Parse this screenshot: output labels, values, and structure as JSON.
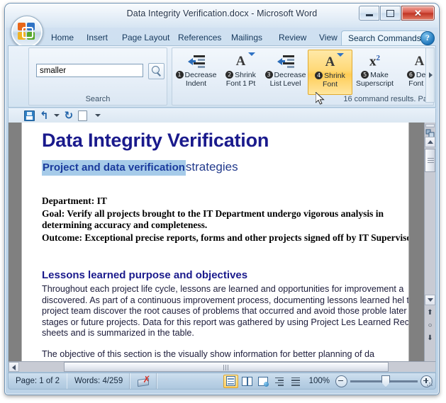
{
  "window": {
    "title": "Data Integrity Verification.docx - Microsoft Word",
    "office_button": "office-orb",
    "minimize_label": "",
    "maximize_label": "",
    "close_label": "✕"
  },
  "tabs": [
    {
      "label": "Home",
      "active": false
    },
    {
      "label": "Insert",
      "active": false
    },
    {
      "label": "Page Layout",
      "active": false
    },
    {
      "label": "References",
      "active": false
    },
    {
      "label": "Mailings",
      "active": false
    },
    {
      "label": "Review",
      "active": false
    },
    {
      "label": "View",
      "active": false
    },
    {
      "label": "Search Commands",
      "active": true
    }
  ],
  "help": {
    "label": "?"
  },
  "ribbon": {
    "search_group": {
      "label": "Search",
      "input_value": "smaller",
      "input_placeholder": "",
      "go_icon": "magnifier-icon"
    },
    "results_group": {
      "commands": [
        {
          "num": "1",
          "line1": "Decrease",
          "line2": "Indent",
          "icon": "decrease-indent-icon",
          "selected": false,
          "dropdown": false
        },
        {
          "num": "2",
          "line1": "Shrink",
          "line2": "Font 1 Pt",
          "icon": "font-a-icon",
          "selected": false,
          "dropdown": true
        },
        {
          "num": "3",
          "line1": "Decrease",
          "line2": "List Level",
          "icon": "decrease-indent-icon",
          "selected": false,
          "dropdown": false
        },
        {
          "num": "4",
          "line1": "Shrink",
          "line2": "Font",
          "icon": "font-a-icon",
          "selected": true,
          "dropdown": true
        },
        {
          "num": "5",
          "line1": "Make",
          "line2": "Superscript",
          "icon": "superscript-icon",
          "selected": false,
          "dropdown": false
        },
        {
          "num": "6",
          "line1": "Decr",
          "line2": "Font S",
          "icon": "font-a-icon",
          "selected": false,
          "dropdown": true
        }
      ],
      "results_note": "16 command results. Pa"
    }
  },
  "quick_access": {
    "items": [
      {
        "name": "save-icon",
        "label": ""
      },
      {
        "name": "undo-icon",
        "label": "↰"
      },
      {
        "name": "undo-dropdown-icon",
        "label": ""
      },
      {
        "name": "redo-icon",
        "label": "↻"
      },
      {
        "name": "new-document-icon",
        "label": ""
      },
      {
        "name": "customize-qat-icon",
        "label": ""
      }
    ]
  },
  "document": {
    "title": "Data Integrity Verification",
    "subtitle_selected": "Project and data verification",
    "subtitle_rest": "strategies",
    "meta": [
      "Department:  IT",
      "Goal:  Verify all projects brought to the IT Department  undergo vigorous analysis in determining accuracy  and completeness.",
      "Outcome:  Exceptional precise reports, forms and other projects signed off by IT Supervisor."
    ],
    "heading2": "Lessons learned purpose and objectives",
    "paragraph1": "Throughout each  project life cycle, lessons are learned  and opportunities for improvement a discovered. As part of a continuous improvement process, documenting lessons learned hel the project team discover the root causes of problems that occurred and avoid those proble later project stages or future projects. Data for this report was  gathered by using Project Les Learned Record sheets and is summarized in the table.",
    "paragraph2": "The objective of this section is the visually show information for better planning of da"
  },
  "statusbar": {
    "page": "Page: 1 of 2",
    "words": "Words: 4/259",
    "proofing_icon": "spelling-errors-icon",
    "views": [
      {
        "name": "print-layout-view",
        "active": true
      },
      {
        "name": "full-screen-reading-view",
        "active": false
      },
      {
        "name": "web-layout-view",
        "active": false
      },
      {
        "name": "outline-view",
        "active": false
      },
      {
        "name": "draft-view",
        "active": false
      }
    ],
    "zoom_level": "100%",
    "zoom_out_icon": "zoom-out-icon",
    "zoom_in_icon": "zoom-in-icon"
  },
  "colors": {
    "accent_selected": "#ffd978",
    "doc_heading": "#1a1a8c",
    "selection_highlight": "#a6cbe9",
    "close_button": "#c03524"
  }
}
